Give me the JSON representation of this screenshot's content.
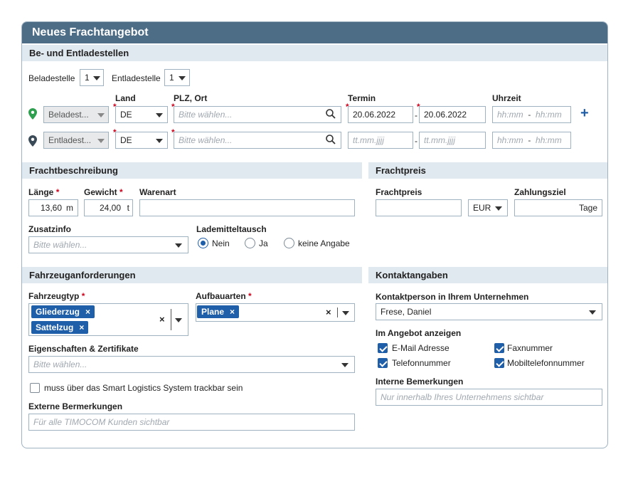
{
  "title": "Neues Frachtangebot",
  "sections": {
    "stops": "Be- und Entladestellen",
    "description": "Frachtbeschreibung",
    "price": "Frachtpreis",
    "vehicle": "Fahrzeuganforderungen",
    "contact": "Kontaktangaben"
  },
  "stops": {
    "loading_label": "Beladestelle",
    "loading_count": "1",
    "unloading_label": "Entladestelle",
    "unloading_count": "1",
    "col_country": "Land",
    "col_zip": "PLZ, Ort",
    "col_date": "Termin",
    "col_time": "Uhrzeit",
    "dash": "-",
    "rows": [
      {
        "type": "Beladest...",
        "country": "DE",
        "zip_placeholder": "Bitte wählen...",
        "date_from": "20.06.2022",
        "date_to": "20.06.2022",
        "time_from": "hh:mm",
        "time_to": "hh:mm"
      },
      {
        "type": "Entladest...",
        "country": "DE",
        "zip_placeholder": "Bitte wählen...",
        "date_from": "tt.mm.jjjj",
        "date_to": "tt.mm.jjjj",
        "time_from": "hh:mm",
        "time_to": "hh:mm"
      }
    ],
    "add": "+"
  },
  "description": {
    "length_label": "Länge",
    "length_value": "13,60",
    "length_unit": "m",
    "weight_label": "Gewicht",
    "weight_value": "24,00",
    "weight_unit": "t",
    "goods_label": "Warenart",
    "goods_value": "",
    "extra_label": "Zusatzinfo",
    "extra_placeholder": "Bitte wählen...",
    "exchange_label": "Lademitteltausch",
    "exchange_options": [
      "Nein",
      "Ja",
      "keine Angabe"
    ],
    "exchange_selected": "Nein"
  },
  "price": {
    "price_label": "Frachtpreis",
    "price_value": "",
    "currency": "EUR",
    "terms_label": "Zahlungsziel",
    "terms_unit": "Tage"
  },
  "vehicle": {
    "type_label": "Fahrzeugtyp",
    "types": [
      "Gliederzug",
      "Sattelzug"
    ],
    "body_label": "Aufbauarten",
    "bodies": [
      "Plane"
    ],
    "props_label": "Eigenschaften & Zertifikate",
    "props_placeholder": "Bitte wählen...",
    "tracking_label": "muss über das Smart Logistics System trackbar sein",
    "tracking_checked": false,
    "remarks_label": "Externe Bermerkungen",
    "remarks_placeholder": "Für alle TIMOCOM Kunden sichtbar"
  },
  "contact": {
    "person_label": "Kontaktperson in Ihrem Unternehmen",
    "person_value": "Frese, Daniel",
    "show_label": "Im Angebot anzeigen",
    "show_options": [
      {
        "label": "E-Mail Adresse",
        "checked": true
      },
      {
        "label": "Faxnummer",
        "checked": true
      },
      {
        "label": "Telefonnummer",
        "checked": true
      },
      {
        "label": "Mobiltelefonnummer",
        "checked": true
      }
    ],
    "internal_label": "Interne Bemerkungen",
    "internal_placeholder": "Nur innerhalb Ihres Unternehmens sichtbar"
  },
  "colors": {
    "header": "#4d6d87",
    "accent": "#1f5ea8",
    "section_bg": "#e1e9f0",
    "required": "#d0021b",
    "pin_green": "#2e9e4f",
    "pin_dark": "#3b4a57"
  },
  "icons": {
    "remove": "×",
    "search": "search-icon",
    "pin": "map-pin-icon"
  }
}
